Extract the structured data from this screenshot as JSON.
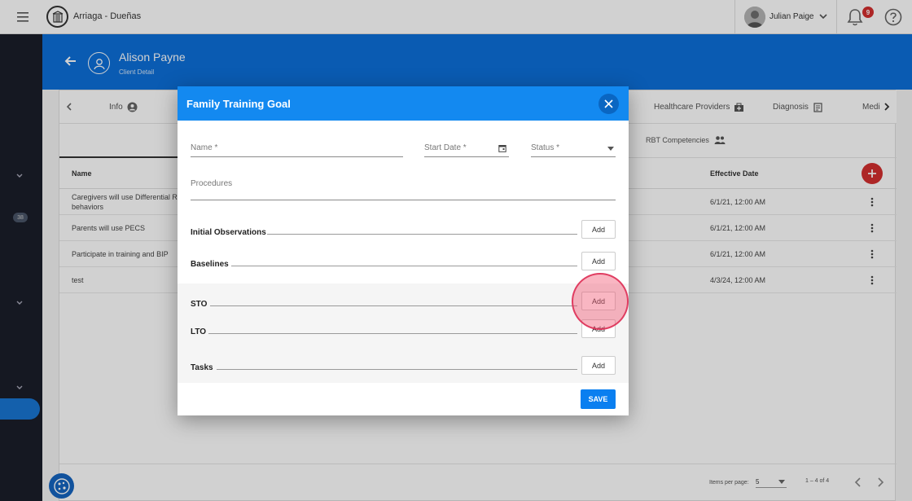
{
  "topbar": {
    "org_name": "Arriaga - Dueñas",
    "user_name": "Julian Paige",
    "notifications_count": "9"
  },
  "sidebar": {
    "badge": "38"
  },
  "header": {
    "client_name": "Alison Payne",
    "client_sub": "Client Detail"
  },
  "tabs": {
    "info": "Info",
    "healthcare_providers": "Healthcare Providers",
    "diagnosis": "Diagnosis",
    "medi": "Medi"
  },
  "subtabs": {
    "rbt": "RBT Competencies"
  },
  "table": {
    "col_name": "Name",
    "col_effective": "Effective Date",
    "rows": [
      {
        "name": "Caregivers will use Differential Re",
        "name2": "behaviors",
        "date": "6/1/21, 12:00 AM"
      },
      {
        "name": "Parents will use PECS",
        "date": "6/1/21, 12:00 AM"
      },
      {
        "name": "Participate in training and BIP",
        "date": "6/1/21, 12:00 AM"
      },
      {
        "name": "test",
        "date": "4/3/24, 12:00 AM"
      }
    ]
  },
  "pager": {
    "label": "Items per page:",
    "value": "5",
    "range": "1 – 4 of 4"
  },
  "dialog": {
    "title": "Family Training Goal",
    "name_label": "Name *",
    "start_date_label": "Start Date *",
    "status_label": "Status *",
    "procedures_label": "Procedures",
    "sections": {
      "initial": "Initial Observations",
      "baselines": "Baselines",
      "sto": "STO",
      "lto": "LTO",
      "tasks": "Tasks"
    },
    "add_label": "Add",
    "save_label": "SAVE"
  }
}
